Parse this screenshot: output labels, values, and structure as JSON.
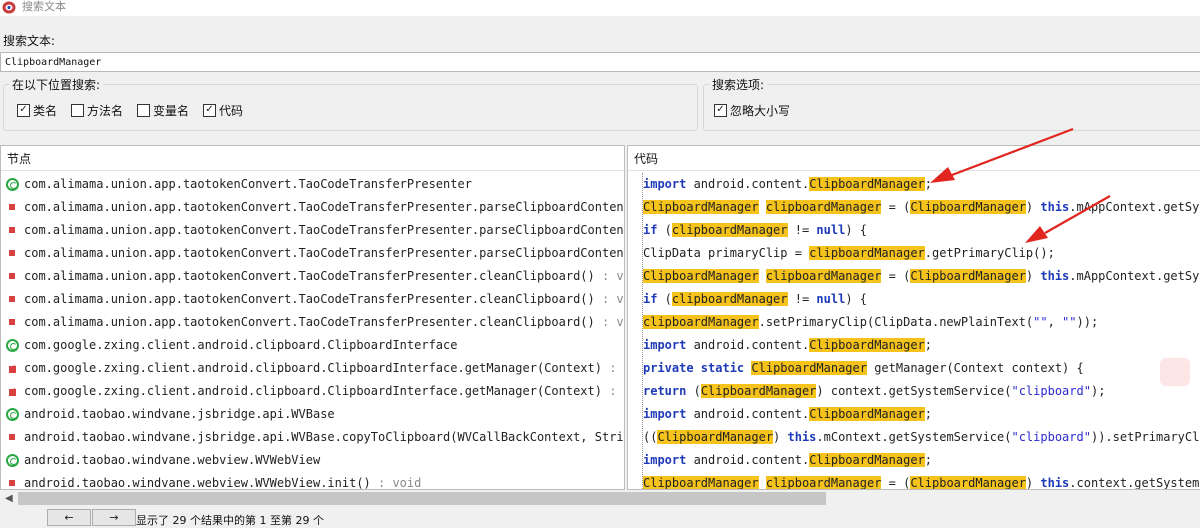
{
  "window": {
    "title": "搜索文本"
  },
  "search": {
    "label": "搜索文本:",
    "value": "ClipboardManager"
  },
  "scope": {
    "legend": "在以下位置搜索:",
    "options": [
      {
        "label": "类名",
        "checked": true
      },
      {
        "label": "方法名",
        "checked": false
      },
      {
        "label": "变量名",
        "checked": false
      },
      {
        "label": "代码",
        "checked": true
      }
    ]
  },
  "search_options": {
    "legend": "搜索选项:",
    "options": [
      {
        "label": "忽略大小写",
        "checked": true
      }
    ]
  },
  "node_pane": {
    "header": "节点",
    "rows": [
      {
        "icon": "class",
        "text": "com.alimama.union.app.taotokenConvert.TaoCodeTransferPresenter",
        "suffix": ""
      },
      {
        "icon": "method",
        "text": "com.alimama.union.app.taotokenConvert.TaoCodeTransferPresenter.parseClipboardContent()",
        "suffix": ""
      },
      {
        "icon": "method",
        "text": "com.alimama.union.app.taotokenConvert.TaoCodeTransferPresenter.parseClipboardContent()",
        "suffix": ""
      },
      {
        "icon": "method",
        "text": "com.alimama.union.app.taotokenConvert.TaoCodeTransferPresenter.parseClipboardContent()",
        "suffix": ""
      },
      {
        "icon": "method",
        "text": "com.alimama.union.app.taotokenConvert.TaoCodeTransferPresenter.cleanClipboard()",
        "suffix": " : void"
      },
      {
        "icon": "method",
        "text": "com.alimama.union.app.taotokenConvert.TaoCodeTransferPresenter.cleanClipboard()",
        "suffix": " : void"
      },
      {
        "icon": "method",
        "text": "com.alimama.union.app.taotokenConvert.TaoCodeTransferPresenter.cleanClipboard()",
        "suffix": " : void"
      },
      {
        "icon": "class",
        "text": "com.google.zxing.client.android.clipboard.ClipboardInterface",
        "suffix": ""
      },
      {
        "icon": "static",
        "text": "com.google.zxing.client.android.clipboard.ClipboardInterface.getManager(Context)",
        "suffix": " : Cli"
      },
      {
        "icon": "static",
        "text": "com.google.zxing.client.android.clipboard.ClipboardInterface.getManager(Context)",
        "suffix": " : Cli"
      },
      {
        "icon": "class",
        "text": "android.taobao.windvane.jsbridge.api.WVBase",
        "suffix": ""
      },
      {
        "icon": "method",
        "text": "android.taobao.windvane.jsbridge.api.WVBase.copyToClipboard(WVCallBackContext, String)",
        "suffix": ""
      },
      {
        "icon": "class",
        "text": "android.taobao.windvane.webview.WVWebView",
        "suffix": ""
      },
      {
        "icon": "method",
        "text": "android.taobao.windvane.webview.WVWebView.init()",
        "suffix": " : void"
      }
    ]
  },
  "code_pane": {
    "header": "代码",
    "rows": [
      [
        {
          "t": "import",
          "c": "kw"
        },
        {
          "t": " android.content."
        },
        {
          "t": "ClipboardManager",
          "c": "hl"
        },
        {
          "t": ";"
        }
      ],
      [
        {
          "t": "ClipboardManager",
          "c": "hl"
        },
        {
          "t": " "
        },
        {
          "t": "clipboardManager",
          "c": "hl"
        },
        {
          "t": " = ("
        },
        {
          "t": "ClipboardManager",
          "c": "hl"
        },
        {
          "t": ") "
        },
        {
          "t": "this",
          "c": "kw"
        },
        {
          "t": ".mAppContext.getSyst"
        }
      ],
      [
        {
          "t": "if",
          "c": "kw"
        },
        {
          "t": " ("
        },
        {
          "t": "clipboardManager",
          "c": "hl"
        },
        {
          "t": " != "
        },
        {
          "t": "null",
          "c": "kw"
        },
        {
          "t": ") {"
        }
      ],
      [
        {
          "t": "ClipData primaryClip = "
        },
        {
          "t": "clipboardManager",
          "c": "hl"
        },
        {
          "t": ".getPrimaryClip();"
        }
      ],
      [
        {
          "t": "ClipboardManager",
          "c": "hl"
        },
        {
          "t": " "
        },
        {
          "t": "clipboardManager",
          "c": "hl"
        },
        {
          "t": " = ("
        },
        {
          "t": "ClipboardManager",
          "c": "hl"
        },
        {
          "t": ") "
        },
        {
          "t": "this",
          "c": "kw"
        },
        {
          "t": ".mAppContext.getSyst"
        }
      ],
      [
        {
          "t": "if",
          "c": "kw"
        },
        {
          "t": " ("
        },
        {
          "t": "clipboardManager",
          "c": "hl"
        },
        {
          "t": " != "
        },
        {
          "t": "null",
          "c": "kw"
        },
        {
          "t": ") {"
        }
      ],
      [
        {
          "t": "clipboardManager",
          "c": "hl"
        },
        {
          "t": ".setPrimaryClip(ClipData.newPlainText("
        },
        {
          "t": "\"\"",
          "c": "str"
        },
        {
          "t": ", "
        },
        {
          "t": "\"\"",
          "c": "str"
        },
        {
          "t": "));"
        }
      ],
      [
        {
          "t": "import",
          "c": "kw"
        },
        {
          "t": " android.content."
        },
        {
          "t": "ClipboardManager",
          "c": "hl"
        },
        {
          "t": ";"
        }
      ],
      [
        {
          "t": "private static",
          "c": "kw"
        },
        {
          "t": " "
        },
        {
          "t": "ClipboardManager",
          "c": "hl"
        },
        {
          "t": " getManager(Context context) {"
        }
      ],
      [
        {
          "t": "return",
          "c": "kw"
        },
        {
          "t": " ("
        },
        {
          "t": "ClipboardManager",
          "c": "hl"
        },
        {
          "t": ") context.getSystemService("
        },
        {
          "t": "\"clipboard\"",
          "c": "str"
        },
        {
          "t": ");"
        }
      ],
      [
        {
          "t": "import",
          "c": "kw"
        },
        {
          "t": " android.content."
        },
        {
          "t": "ClipboardManager",
          "c": "hl"
        },
        {
          "t": ";"
        }
      ],
      [
        {
          "t": "(("
        },
        {
          "t": "ClipboardManager",
          "c": "hl"
        },
        {
          "t": ") "
        },
        {
          "t": "this",
          "c": "kw"
        },
        {
          "t": ".mContext.getSystemService("
        },
        {
          "t": "\"clipboard\"",
          "c": "str"
        },
        {
          "t": ")).setPrimaryClip"
        }
      ],
      [
        {
          "t": "import",
          "c": "kw"
        },
        {
          "t": " android.content."
        },
        {
          "t": "ClipboardManager",
          "c": "hl"
        },
        {
          "t": ";"
        }
      ],
      [
        {
          "t": "ClipboardManager",
          "c": "hl"
        },
        {
          "t": " "
        },
        {
          "t": "clipboardManager",
          "c": "hl"
        },
        {
          "t": " = ("
        },
        {
          "t": "ClipboardManager",
          "c": "hl"
        },
        {
          "t": ") "
        },
        {
          "t": "this",
          "c": "kw"
        },
        {
          "t": ".context.getSystemSe"
        }
      ]
    ]
  },
  "footer": {
    "prev_label": "←",
    "next_label": "→",
    "status": "显示了 29 个结果中的第 1 至第 29 个"
  },
  "colors": {
    "highlight": "#f5c31b",
    "keyword": "#1e3ab8",
    "annotation_arrow": "#e0261f"
  }
}
